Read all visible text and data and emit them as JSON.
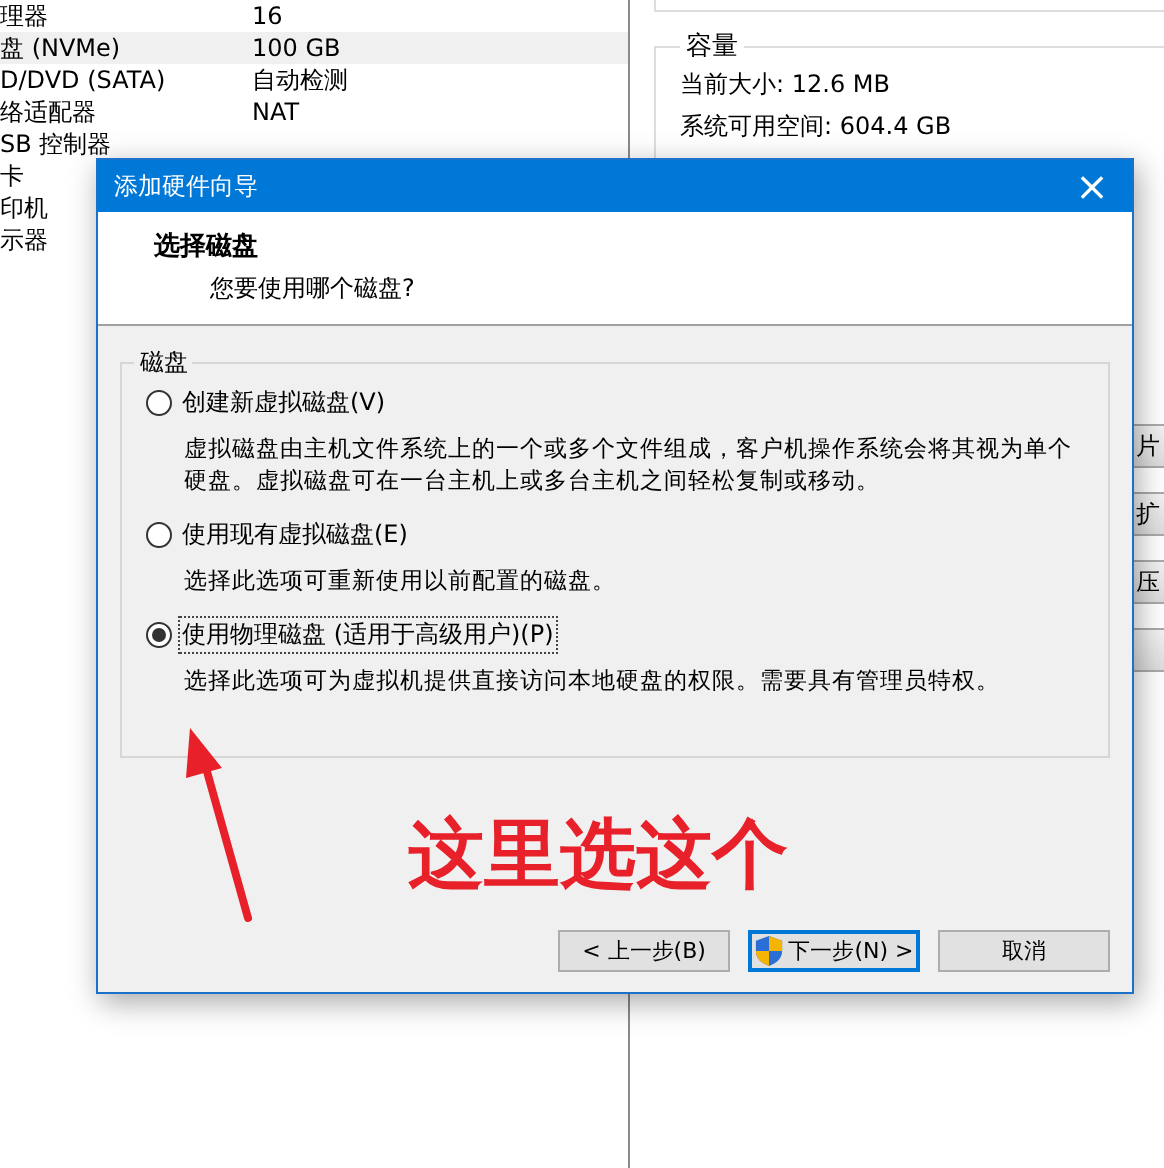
{
  "background_window": {
    "hardware_list": [
      {
        "device": "理器",
        "summary": "16",
        "selected": false
      },
      {
        "device": "盘 (NVMe)",
        "summary": "100 GB",
        "selected": true
      },
      {
        "device": "D/DVD (SATA)",
        "summary": "自动检测",
        "selected": false
      },
      {
        "device": "络适配器",
        "summary": "NAT",
        "selected": false
      },
      {
        "device": "SB 控制器",
        "selected": false
      },
      {
        "device": "卡",
        "selected": false
      },
      {
        "device": "印机",
        "selected": false
      },
      {
        "device": "示器",
        "selected": false
      }
    ],
    "capacity": {
      "title": "容量",
      "lines": [
        "当前大小: 12.6 MB",
        "系统可用空间: 604.4 GB"
      ]
    },
    "side_buttons": [
      "片",
      "扩",
      "压"
    ]
  },
  "dialog": {
    "title": "添加硬件向导",
    "close": "×",
    "heading": "选择磁盘",
    "subheading": "您要使用哪个磁盘?",
    "group": {
      "title": "磁盘",
      "options": [
        {
          "label": "创建新虚拟磁盘(V)",
          "description": "虚拟磁盘由主机文件系统上的一个或多个文件组成，客户机操作系统会将其视为单个硬盘。虚拟磁盘可在一台主机上或多台主机之间轻松复制或移动。",
          "selected": false
        },
        {
          "label": "使用现有虚拟磁盘(E)",
          "description": "选择此选项可重新使用以前配置的磁盘。",
          "selected": false
        },
        {
          "label": "使用物理磁盘 (适用于高级用户)(P)",
          "description": "选择此选项可为虚拟机提供直接访问本地硬盘的权限。需要具有管理员特权。",
          "selected": true
        }
      ]
    },
    "buttons": [
      {
        "label": "< 上一步(B)",
        "kind": "plain"
      },
      {
        "label": "下一步(N) >",
        "kind": "shield"
      },
      {
        "label": "取消",
        "kind": "plain"
      }
    ]
  },
  "annotation": {
    "text": "这里选这个"
  }
}
